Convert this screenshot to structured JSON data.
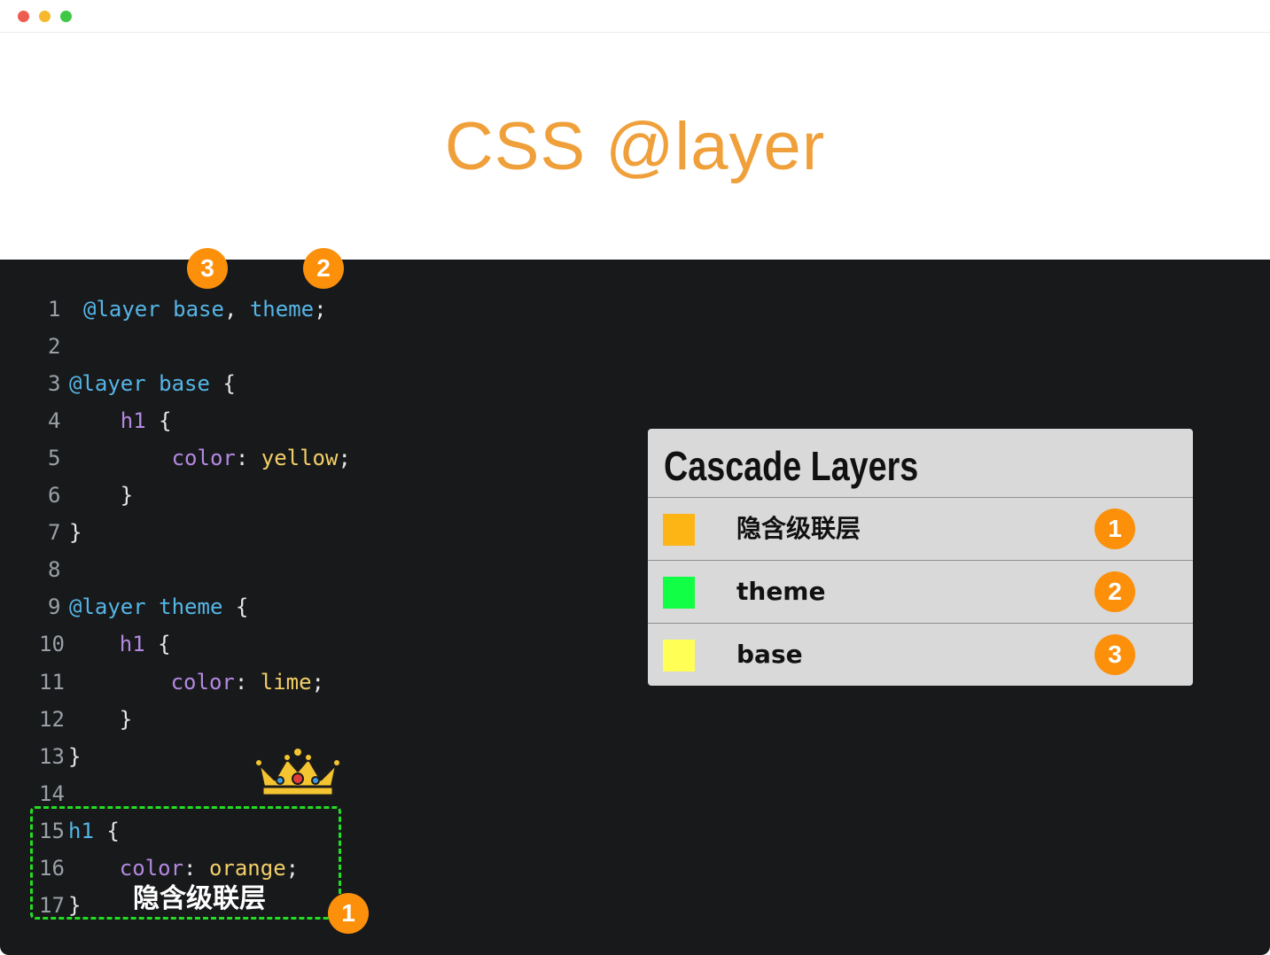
{
  "window": {
    "controls": [
      "close",
      "minimize",
      "zoom"
    ],
    "control_colors": [
      "#ee5b4f",
      "#f6b92d",
      "#3ec846"
    ]
  },
  "page": {
    "title": "CSS @layer",
    "title_color": "#f0a03a",
    "editor_background": "#18191b",
    "accent_badge_color": "#fc900b"
  },
  "code": {
    "lines": [
      {
        "n": "1",
        "tokens": [
          {
            "t": "@layer",
            "c": "kw"
          },
          {
            "t": " "
          },
          {
            "t": "base",
            "c": "name"
          },
          {
            "t": ", ",
            "c": "punc"
          },
          {
            "t": "theme",
            "c": "name"
          },
          {
            "t": ";",
            "c": "punc"
          }
        ]
      },
      {
        "n": "2",
        "tokens": []
      },
      {
        "n": "3",
        "tokens": [
          {
            "t": "@layer",
            "c": "kw"
          },
          {
            "t": " "
          },
          {
            "t": "base",
            "c": "name"
          },
          {
            "t": " {",
            "c": "punc"
          }
        ]
      },
      {
        "n": "4",
        "tokens": [
          {
            "t": "    "
          },
          {
            "t": "h1",
            "c": "sel"
          },
          {
            "t": " {",
            "c": "punc"
          }
        ]
      },
      {
        "n": "5",
        "tokens": [
          {
            "t": "        "
          },
          {
            "t": "color",
            "c": "prop"
          },
          {
            "t": ": ",
            "c": "punc"
          },
          {
            "t": "yellow",
            "c": "val"
          },
          {
            "t": ";",
            "c": "punc"
          }
        ]
      },
      {
        "n": "6",
        "tokens": [
          {
            "t": "    "
          },
          {
            "t": "}",
            "c": "punc"
          }
        ]
      },
      {
        "n": "7",
        "tokens": [
          {
            "t": "}",
            "c": "punc"
          }
        ]
      },
      {
        "n": "8",
        "tokens": []
      },
      {
        "n": "9",
        "tokens": [
          {
            "t": "@layer",
            "c": "kw"
          },
          {
            "t": " "
          },
          {
            "t": "theme",
            "c": "name"
          },
          {
            "t": " {",
            "c": "punc"
          }
        ]
      },
      {
        "n": "10",
        "tokens": [
          {
            "t": "    "
          },
          {
            "t": "h1",
            "c": "sel"
          },
          {
            "t": " {",
            "c": "punc"
          }
        ]
      },
      {
        "n": "11",
        "tokens": [
          {
            "t": "        "
          },
          {
            "t": "color",
            "c": "prop"
          },
          {
            "t": ": ",
            "c": "punc"
          },
          {
            "t": "lime",
            "c": "val"
          },
          {
            "t": ";",
            "c": "punc"
          }
        ]
      },
      {
        "n": "12",
        "tokens": [
          {
            "t": "    "
          },
          {
            "t": "}",
            "c": "punc"
          }
        ]
      },
      {
        "n": "13",
        "tokens": [
          {
            "t": "}",
            "c": "punc"
          }
        ]
      },
      {
        "n": "14",
        "tokens": []
      },
      {
        "n": "15",
        "tokens": [
          {
            "t": "h1",
            "c": "kw"
          },
          {
            "t": " {",
            "c": "punc"
          }
        ]
      },
      {
        "n": "16",
        "tokens": [
          {
            "t": "    "
          },
          {
            "t": "color",
            "c": "prop"
          },
          {
            "t": ": ",
            "c": "punc"
          },
          {
            "t": "orange",
            "c": "val"
          },
          {
            "t": ";",
            "c": "punc"
          }
        ]
      },
      {
        "n": "17",
        "tokens": [
          {
            "t": "}",
            "c": "punc"
          }
        ]
      }
    ]
  },
  "annotations": {
    "base_order_badge": "3",
    "theme_order_badge": "2",
    "implicit_order_badge": "1",
    "implicit_caption": "隐含级联层",
    "crown_icon": "crown-icon",
    "implicit_box_color": "#22dd22"
  },
  "legend": {
    "title": "Cascade Layers",
    "rows": [
      {
        "label": "隐含级联层",
        "color": "#fdb515",
        "rank": "1"
      },
      {
        "label": "theme",
        "color": "#11ff44",
        "rank": "2"
      },
      {
        "label": "base",
        "color": "#ffff55",
        "rank": "3"
      }
    ]
  }
}
